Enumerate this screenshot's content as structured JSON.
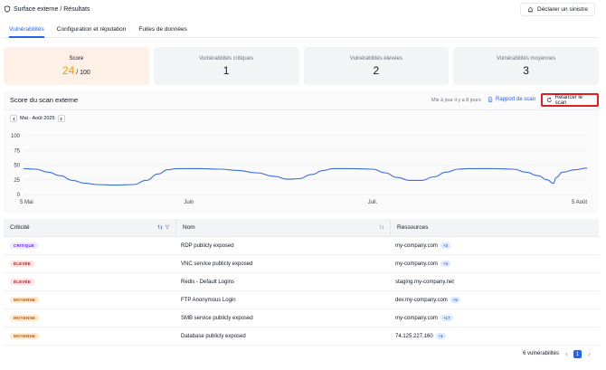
{
  "header": {
    "breadcrumb": "Surface externe / Résultats",
    "declare_button": "Déclarer un sinistre"
  },
  "tabs": [
    {
      "label": "Vulnérabilités",
      "active": true
    },
    {
      "label": "Configuration et réputation",
      "active": false
    },
    {
      "label": "Fuites de données",
      "active": false
    }
  ],
  "stats": {
    "score_label": "Score",
    "score_value": "24",
    "score_max": "/ 100",
    "critical_label": "Vulnérabilités critiques",
    "critical_value": "1",
    "high_label": "Vulnérabilités élevées",
    "high_value": "2",
    "medium_label": "Vulnérabilités moyennes",
    "medium_value": "3"
  },
  "scan_panel": {
    "title": "Score du scan externe",
    "updated": "Mis à jour il y a 8 jours",
    "report_link": "Rapport de scan",
    "rescan_button": "Relancer le scan",
    "period": "Mai - Août 2025"
  },
  "chart_data": {
    "type": "line",
    "ylim": [
      0,
      100
    ],
    "yticks": [
      "100",
      "75",
      "50",
      "25",
      "0"
    ],
    "xticks": [
      {
        "label": "5 Mai",
        "day": 0
      },
      {
        "label": "Juin",
        "day": 27
      },
      {
        "label": "Juil.",
        "day": 57
      },
      {
        "label": "5 Août",
        "day": 92
      }
    ],
    "x_range_days": [
      0,
      92
    ],
    "series": [
      {
        "color": "#3b6fd4",
        "points": [
          [
            0,
            44
          ],
          [
            2,
            43
          ],
          [
            4,
            38
          ],
          [
            6,
            32
          ],
          [
            8,
            24
          ],
          [
            10,
            19
          ],
          [
            12,
            17
          ],
          [
            15,
            16
          ],
          [
            18,
            17
          ],
          [
            20,
            24
          ],
          [
            22,
            35
          ],
          [
            23.5,
            42
          ],
          [
            25,
            44
          ],
          [
            29,
            44
          ],
          [
            32,
            43
          ],
          [
            35,
            41
          ],
          [
            38,
            37
          ],
          [
            41,
            31
          ],
          [
            43,
            26
          ],
          [
            45,
            27
          ],
          [
            47,
            34
          ],
          [
            49,
            41
          ],
          [
            50.5,
            44
          ],
          [
            54,
            44
          ],
          [
            57,
            43
          ],
          [
            59,
            37
          ],
          [
            61,
            29
          ],
          [
            63,
            24
          ],
          [
            65,
            24
          ],
          [
            67,
            30
          ],
          [
            69,
            38
          ],
          [
            71,
            43
          ],
          [
            72.5,
            44
          ],
          [
            77,
            44
          ],
          [
            80,
            43
          ],
          [
            82,
            38
          ],
          [
            84,
            32
          ],
          [
            85.5,
            25
          ],
          [
            86.5,
            19
          ],
          [
            87,
            29
          ],
          [
            88,
            38
          ],
          [
            90,
            42
          ],
          [
            92,
            45
          ]
        ]
      }
    ]
  },
  "table": {
    "headers": {
      "criticity": "Criticité",
      "name": "Nom",
      "resources": "Ressources"
    },
    "rows": [
      {
        "severity": "CRITIQUE",
        "level": "critical",
        "name": "RDP publicly exposed",
        "resource": "my-company.com",
        "extra": "+3"
      },
      {
        "severity": "ÉLEVÉE",
        "level": "high",
        "name": "VNC service publicly exposed",
        "resource": "my-company.com",
        "extra": "+3"
      },
      {
        "severity": "ÉLEVÉE",
        "level": "high",
        "name": "Redis - Default Logins",
        "resource": "staging.my-company.net",
        "extra": ""
      },
      {
        "severity": "MOYENNE",
        "level": "medium",
        "name": "FTP Anonymous Login",
        "resource": "dev.my-company.com",
        "extra": "+5"
      },
      {
        "severity": "MOYENNE",
        "level": "medium",
        "name": "SMB service publicly exposed",
        "resource": "my-company.com",
        "extra": "+17"
      },
      {
        "severity": "MOYENNE",
        "level": "medium",
        "name": "Database publicly exposed",
        "resource": "74.125.227.160",
        "extra": "+1"
      }
    ]
  },
  "severity_colors": {
    "critical": {
      "bg": "#ede9fe",
      "fg": "#6d28d9"
    },
    "high": {
      "bg": "#fde2e2",
      "fg": "#b91c1c"
    },
    "medium": {
      "bg": "#fdebd3",
      "fg": "#b45309"
    }
  },
  "footer": {
    "count": "6 vulnérabilités",
    "current_page": "1"
  }
}
